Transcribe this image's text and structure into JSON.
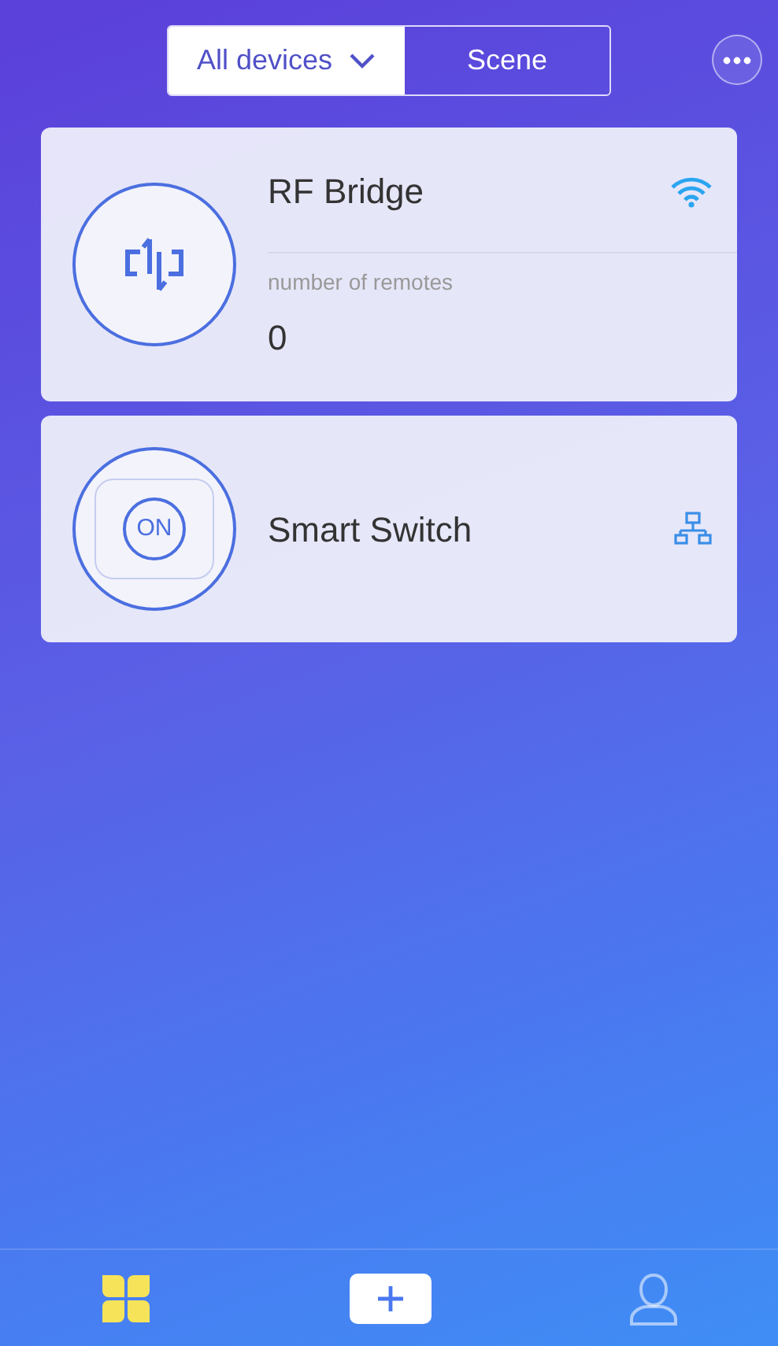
{
  "tabs": [
    {
      "label": "All devices",
      "selected": true,
      "dropdown": true
    },
    {
      "label": "Scene",
      "selected": false,
      "dropdown": false
    }
  ],
  "devices": [
    {
      "kind": "bridge",
      "name": "RF Bridge",
      "status_icon": {
        "kind": "wifi"
      },
      "stat_label": "number of remotes",
      "stat_value": "0"
    },
    {
      "kind": "switch",
      "name": "Smart Switch",
      "status_icon": {
        "kind": "network"
      },
      "icon_text": "ON"
    }
  ],
  "bottom_nav": [
    {
      "kind": "home",
      "selected": true
    },
    {
      "kind": "add",
      "selected": false
    },
    {
      "kind": "profile",
      "selected": false
    }
  ]
}
